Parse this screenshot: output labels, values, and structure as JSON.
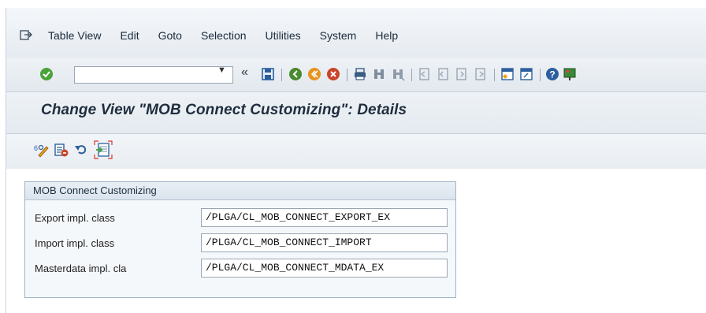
{
  "menu": {
    "items": [
      {
        "label": "Table View"
      },
      {
        "label": "Edit"
      },
      {
        "label": "Goto"
      },
      {
        "label": "Selection"
      },
      {
        "label": "Utilities"
      },
      {
        "label": "System"
      },
      {
        "label": "Help"
      }
    ]
  },
  "toolbar": {
    "command_field_value": "",
    "nav_arrow": "«"
  },
  "title": {
    "text": "Change View \"MOB Connect Customizing\": Details"
  },
  "group": {
    "title": "MOB Connect Customizing",
    "fields": [
      {
        "label": "Export impl. class",
        "value": "/PLGA/CL_MOB_CONNECT_EXPORT_EX"
      },
      {
        "label": "Import impl. class",
        "value": "/PLGA/CL_MOB_CONNECT_IMPORT"
      },
      {
        "label": "Masterdata impl. cla",
        "value": "/PLGA/CL_MOB_CONNECT_MDATA_EX"
      }
    ]
  }
}
